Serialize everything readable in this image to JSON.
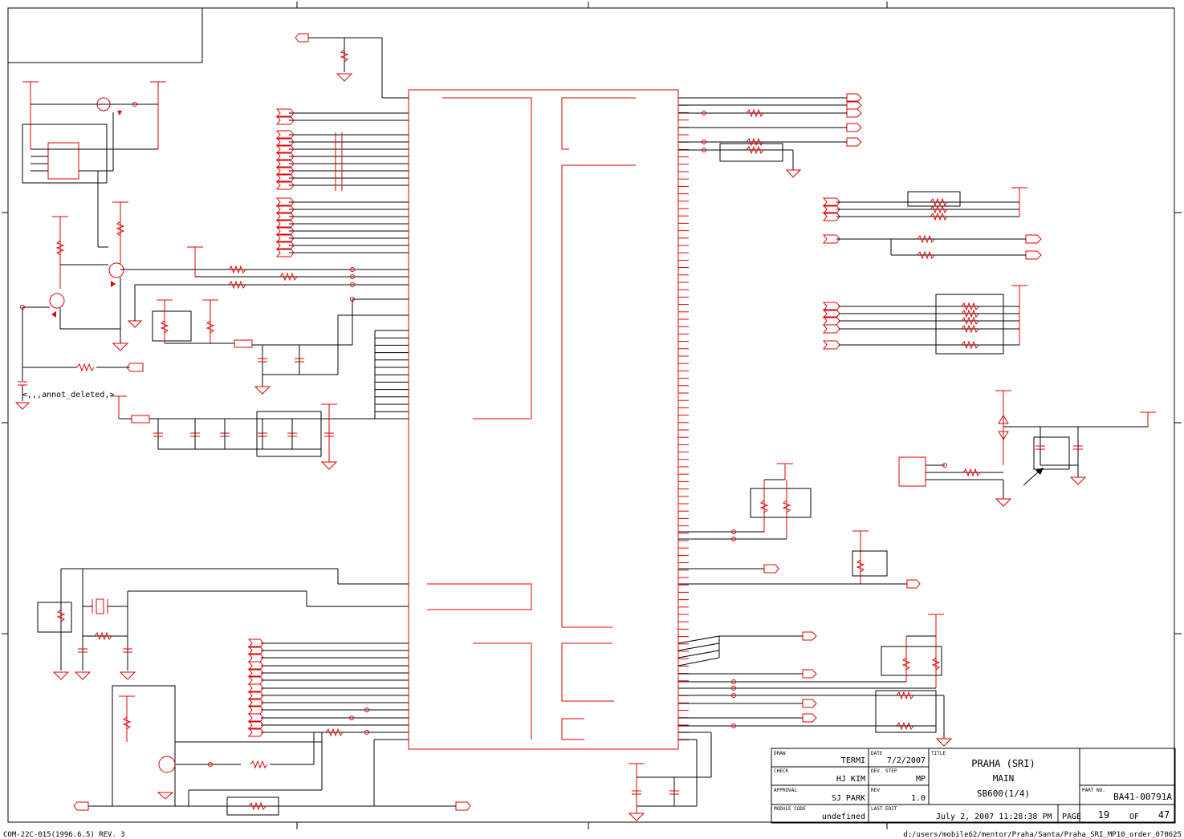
{
  "title_block": {
    "draw_label": "DRAW",
    "draw_value": "TERMI",
    "date_label": "DATE",
    "date_value": "7/2/2007",
    "check_label": "CHECK",
    "check_value": "HJ KIM",
    "dev_step_label": "DEV. STEP",
    "dev_step_value": "MP",
    "approval_label": "APPROVAL",
    "approval_value": "SJ PARK",
    "rev_label": "REV",
    "rev_value": "1.0",
    "module_code_label": "MODULE CODE",
    "module_code_value": "undefined",
    "last_edit_label": "LAST EDIT",
    "last_edit_value": "July 2, 2007  11:28:38 PM",
    "title_label": "TITLE",
    "title_line1": "PRAHA (SRI)",
    "title_line2": "MAIN",
    "title_line3": "SB600(1/4)",
    "part_no_label": "PART NO.",
    "part_no_value": "BA41-00791A",
    "page_label": "PAGE",
    "page_number": "19",
    "of_label": "OF",
    "page_total": "47"
  },
  "footer": {
    "form_code": "COM-22C-015(1996.6.5) REV. 3",
    "file_path": "d:/users/mobile62/mentor/Praha/Santa/Praha_SRI_MP10_order_070625"
  },
  "annotations": {
    "deleted_note": "<,,,annot_deleted,>"
  }
}
